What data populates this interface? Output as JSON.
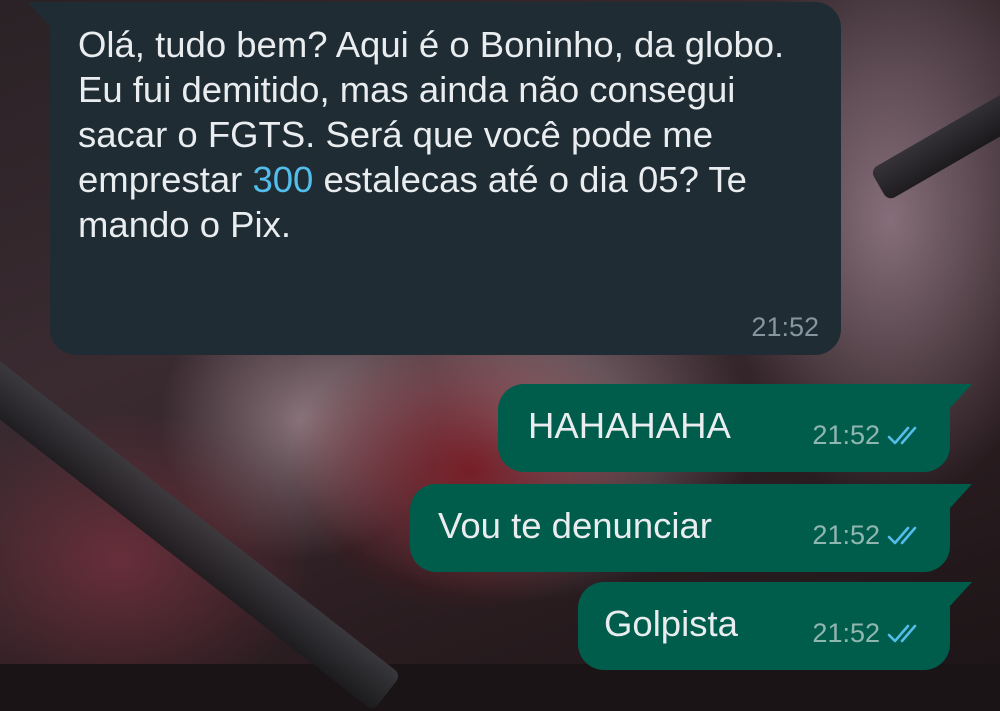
{
  "chat": {
    "incoming_message": {
      "text_before_link": "Olá, tudo bem? Aqui é o Boninho, da globo. Eu fui demitido, mas ainda não consegui sacar o FGTS. Será que você pode me emprestar ",
      "link_text": "300",
      "text_after_link": " estalecas até o dia 05? Te mando o Pix.",
      "time": "21:52"
    },
    "outgoing_messages": [
      {
        "text": "HAHAHAHA",
        "time": "21:52",
        "status": "read"
      },
      {
        "text": "Vou te denunciar",
        "time": "21:52",
        "status": "read"
      },
      {
        "text": "Golpista",
        "time": "21:52",
        "status": "read"
      }
    ]
  },
  "colors": {
    "incoming_bubble": "#1f2c33",
    "outgoing_bubble": "#005c4b",
    "link": "#53bdeb",
    "read_ticks": "#53bdeb"
  },
  "icons": {
    "read_receipt": "double-check-icon"
  }
}
